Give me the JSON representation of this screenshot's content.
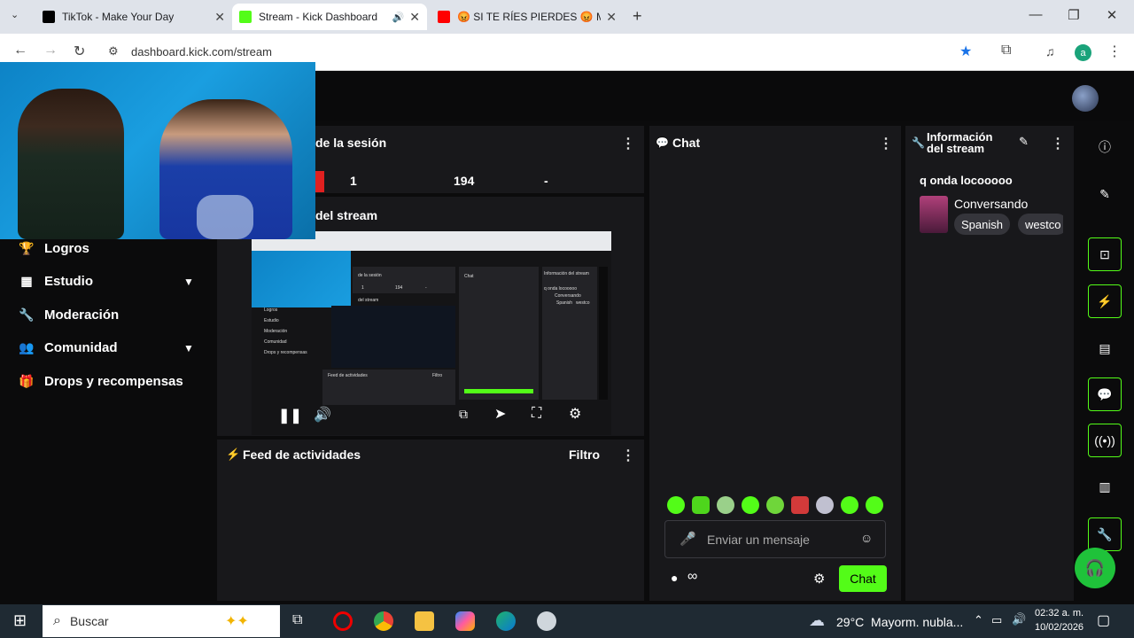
{
  "browser": {
    "tabs": [
      {
        "title": "TikTok - Make Your Day",
        "active": false
      },
      {
        "title": "Stream - Kick Dashboard",
        "active": true
      },
      {
        "title": "😡 SI TE RÍES PIERDES 😡 MEM",
        "active": false
      }
    ],
    "url": "dashboard.kick.com/stream",
    "profile_initial": "a"
  },
  "sidebar": {
    "items": [
      {
        "label": "Logros",
        "icon": "trophy-icon"
      },
      {
        "label": "Estudio",
        "icon": "studio-icon"
      },
      {
        "label": "Moderación",
        "icon": "wrench-icon"
      },
      {
        "label": "Comunidad",
        "icon": "users-icon"
      },
      {
        "label": "Drops y recompensas",
        "icon": "gift-icon"
      }
    ]
  },
  "session": {
    "title": "de la sesión",
    "stats": [
      "1",
      "194",
      "-"
    ]
  },
  "stream_panel": {
    "title": "del stream"
  },
  "activity_feed": {
    "title": "Feed de actividades",
    "filter_label": "Filtro"
  },
  "chat": {
    "title": "Chat",
    "input_placeholder": "Enviar un mensaje",
    "send_label": "Chat",
    "infinity": "∞"
  },
  "stream_info": {
    "title_line1": "Información",
    "title_line2": "del stream",
    "stream_title": "q onda locooooo",
    "category": "Conversando",
    "tags": [
      "Spanish",
      "westco"
    ]
  },
  "video_preview": {
    "mini_labels": {
      "session": "de la sesión",
      "chat": "Chat",
      "info": "Información del stream",
      "onda": "q onda locooooo",
      "conversando": "Conversando",
      "spanish": "Spanish",
      "westco": "westco",
      "logros": "Logros",
      "estudio": "Estudio",
      "moderacion": "Moderación",
      "comunidad": "Comunidad",
      "drops": "Drops y recompensas",
      "feed": "Feed de actividades",
      "filtro": "Filtro",
      "stream": "del stream",
      "one": "1",
      "num": "194",
      "dash": "-"
    }
  },
  "taskbar": {
    "search_placeholder": "Buscar",
    "weather": "29°C  Mayorm. nubla...",
    "time": "02:32 a. m.",
    "date": "10/02/2026"
  },
  "colors": {
    "accent": "#53fc18",
    "panel": "#18181b",
    "bg": "#0b0b0c"
  }
}
